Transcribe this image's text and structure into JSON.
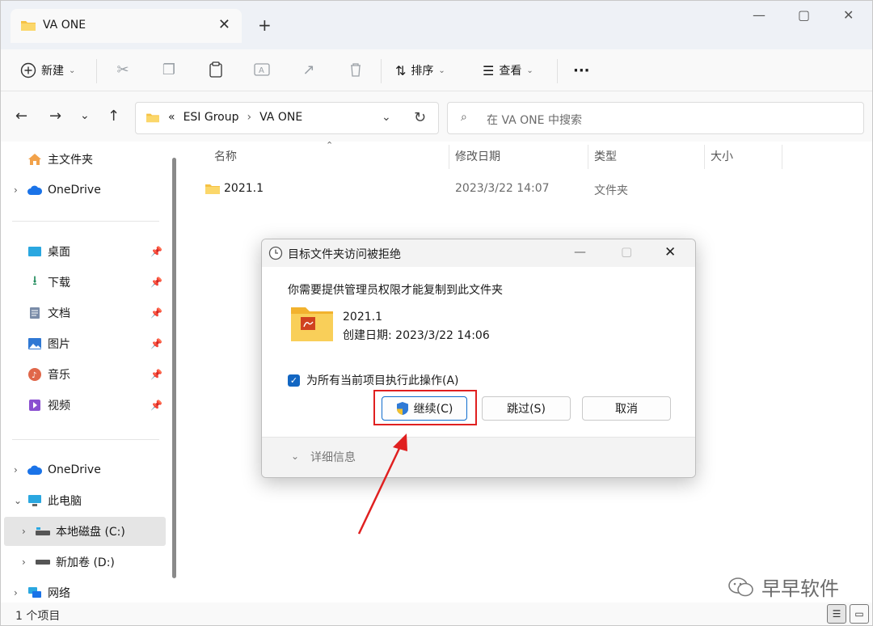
{
  "tab": {
    "title": "VA ONE",
    "close_icon": "close-icon",
    "new_tab": "+"
  },
  "window_controls": {
    "minimize": "—",
    "maximize": "▢",
    "close": "✕"
  },
  "toolbar": {
    "new_label": "新建",
    "sort_label": "排序",
    "view_label": "查看",
    "more": "···"
  },
  "address": {
    "overflow": "«",
    "crumbs": [
      "ESI Group",
      "VA ONE"
    ],
    "search_placeholder": "在 VA ONE 中搜索"
  },
  "sidebar": {
    "home": "主文件夹",
    "onedrive_top": "OneDrive",
    "quick": [
      {
        "label": "桌面"
      },
      {
        "label": "下载"
      },
      {
        "label": "文档"
      },
      {
        "label": "图片"
      },
      {
        "label": "音乐"
      },
      {
        "label": "视频"
      }
    ],
    "onedrive": "OneDrive",
    "this_pc": "此电脑",
    "drive_c": "本地磁盘 (C:)",
    "drive_d": "新加卷 (D:)",
    "network": "网络"
  },
  "columns": {
    "name": "名称",
    "modified": "修改日期",
    "type": "类型",
    "size": "大小"
  },
  "files": [
    {
      "name": "2021.1",
      "modified": "2023/3/22 14:07",
      "type": "文件夹"
    }
  ],
  "status": {
    "count": "1 个项目"
  },
  "dialog": {
    "title": "目标文件夹访问被拒绝",
    "message": "你需要提供管理员权限才能复制到此文件夹",
    "folder_name": "2021.1",
    "folder_created": "创建日期: 2023/3/22 14:06",
    "apply_all": "为所有当前项目执行此操作(A)",
    "continue": "继续(C)",
    "skip": "跳过(S)",
    "cancel": "取消",
    "details": "详细信息"
  },
  "watermark": {
    "text": "早早软件"
  },
  "colors": {
    "accent": "#1266c2",
    "highlight": "#e02020",
    "folder": "#f6c244"
  }
}
